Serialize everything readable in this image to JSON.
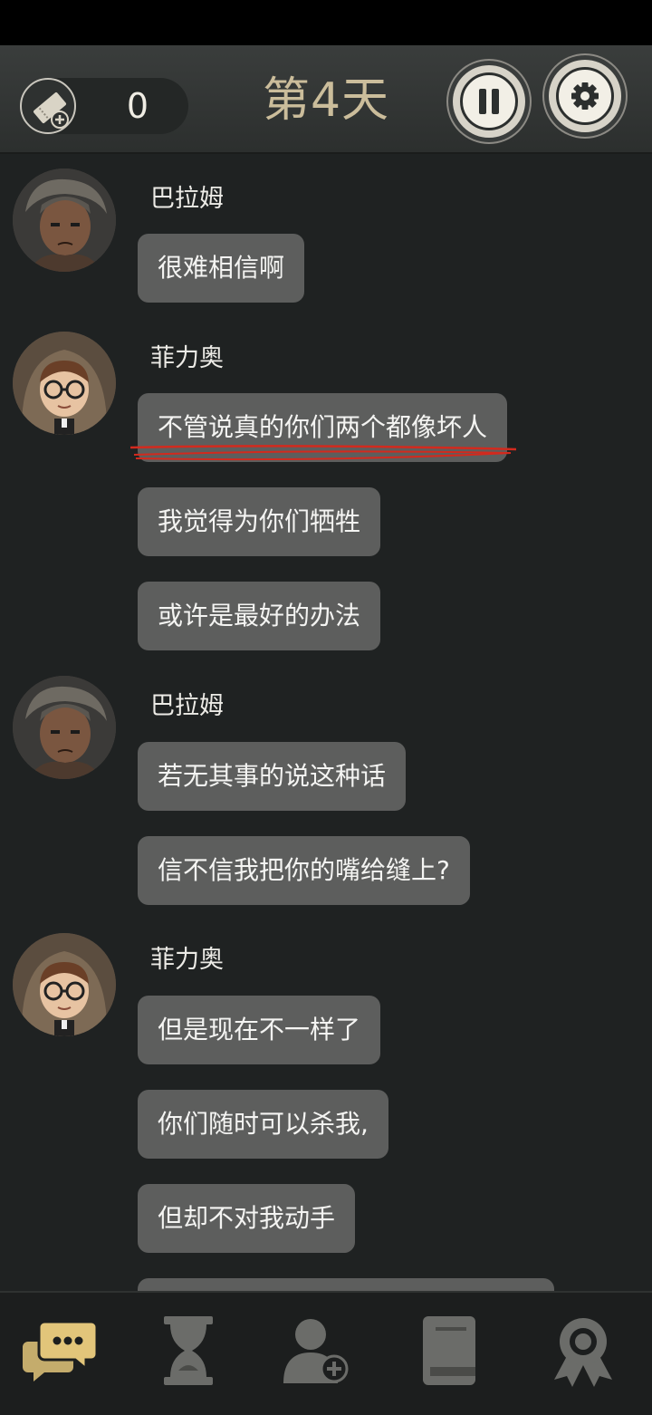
{
  "header": {
    "ticket_count": "0",
    "day_title": "第4天",
    "icons": {
      "ticket": "ticket-add-icon",
      "pause": "pause-icon",
      "settings": "gear-icon"
    }
  },
  "chat": {
    "messages": [
      {
        "sender": "巴拉姆",
        "bubbles": [
          "很难相信啊"
        ]
      },
      {
        "sender": "菲力奥",
        "bubbles": [
          "不管说真的你们两个都像坏人",
          "我觉得为你们牺牲",
          "或许是最好的办法"
        ]
      },
      {
        "sender": "巴拉姆",
        "bubbles": [
          "若无其事的说这种话",
          "信不信我把你的嘴给缝上?"
        ]
      },
      {
        "sender": "菲力奥",
        "bubbles": [
          "但是现在不一样了",
          "你们随时可以杀我,",
          "但却不对我动手"
        ]
      }
    ]
  },
  "nav": {
    "items": [
      "chat-icon",
      "hourglass-icon",
      "add-person-icon",
      "book-icon",
      "badge-icon"
    ],
    "active": "chat-icon"
  },
  "colors": {
    "accent": "#e2c57a",
    "bubble": "#5d5e5d",
    "day_title": "#cbbd9b",
    "underline": "#d22a1e"
  }
}
